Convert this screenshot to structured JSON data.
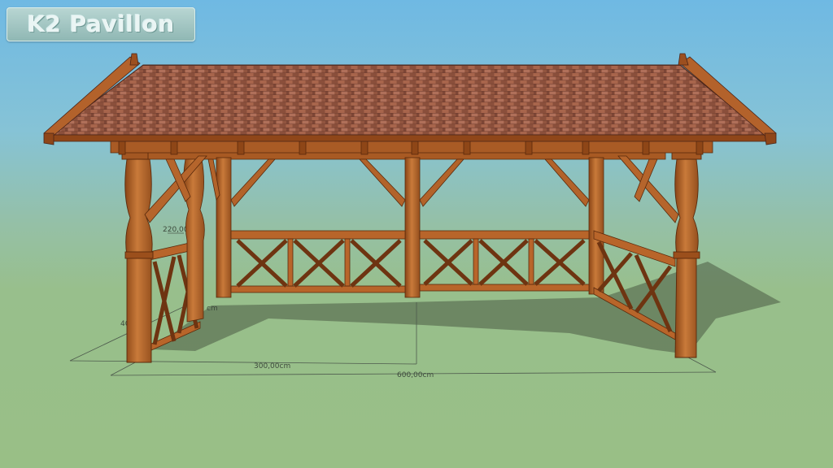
{
  "badge": {
    "title": "K2 Pavillon"
  },
  "dimensions": {
    "height": "220,00",
    "depth_partial": "40",
    "cm_fragment": "cm",
    "depth": "300,00cm",
    "width": "600,00cm"
  },
  "colors": {
    "wood": "#b8652a",
    "wood_dark": "#7a3a12",
    "roof": "#9a5a43",
    "shadow": "#3f4a3a"
  }
}
